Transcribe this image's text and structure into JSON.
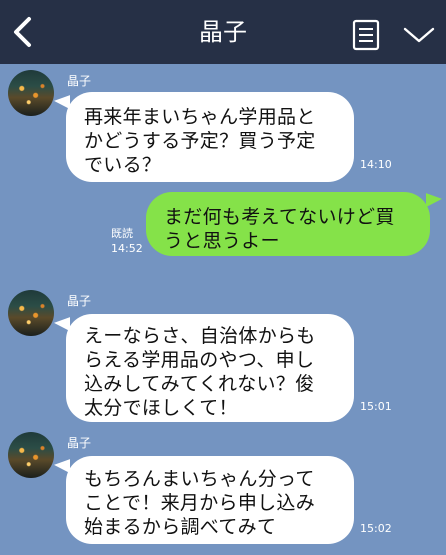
{
  "header": {
    "title": "晶子",
    "back_icon": "chevron-left-icon",
    "menu_icon": "menu-list-icon",
    "expand_icon": "chevron-down-icon",
    "colors": {
      "header_bg": "#263046",
      "chat_bg": "#7494c1"
    }
  },
  "messages": [
    {
      "side": "left",
      "sender": "晶子",
      "text": "再来年まいちゃん学用品と\nかどうする予定？買う予定\nでいる？",
      "time": "14:10"
    },
    {
      "side": "right",
      "text": "まだ何も考えてないけど買\nうと思うよー",
      "read": "既読",
      "time": "14:52"
    },
    {
      "side": "left",
      "sender": "晶子",
      "text": "えーならさ、自治体からも\nらえる学用品のやつ、申し\n込みしてみてくれない？俊\n太分でほしくて！",
      "time": "15:01"
    },
    {
      "side": "left",
      "sender": "晶子",
      "text": "もちろんまいちゃん分って\nことで！来月から申し込み\n始まるから調べてみて",
      "time": "15:02"
    }
  ]
}
